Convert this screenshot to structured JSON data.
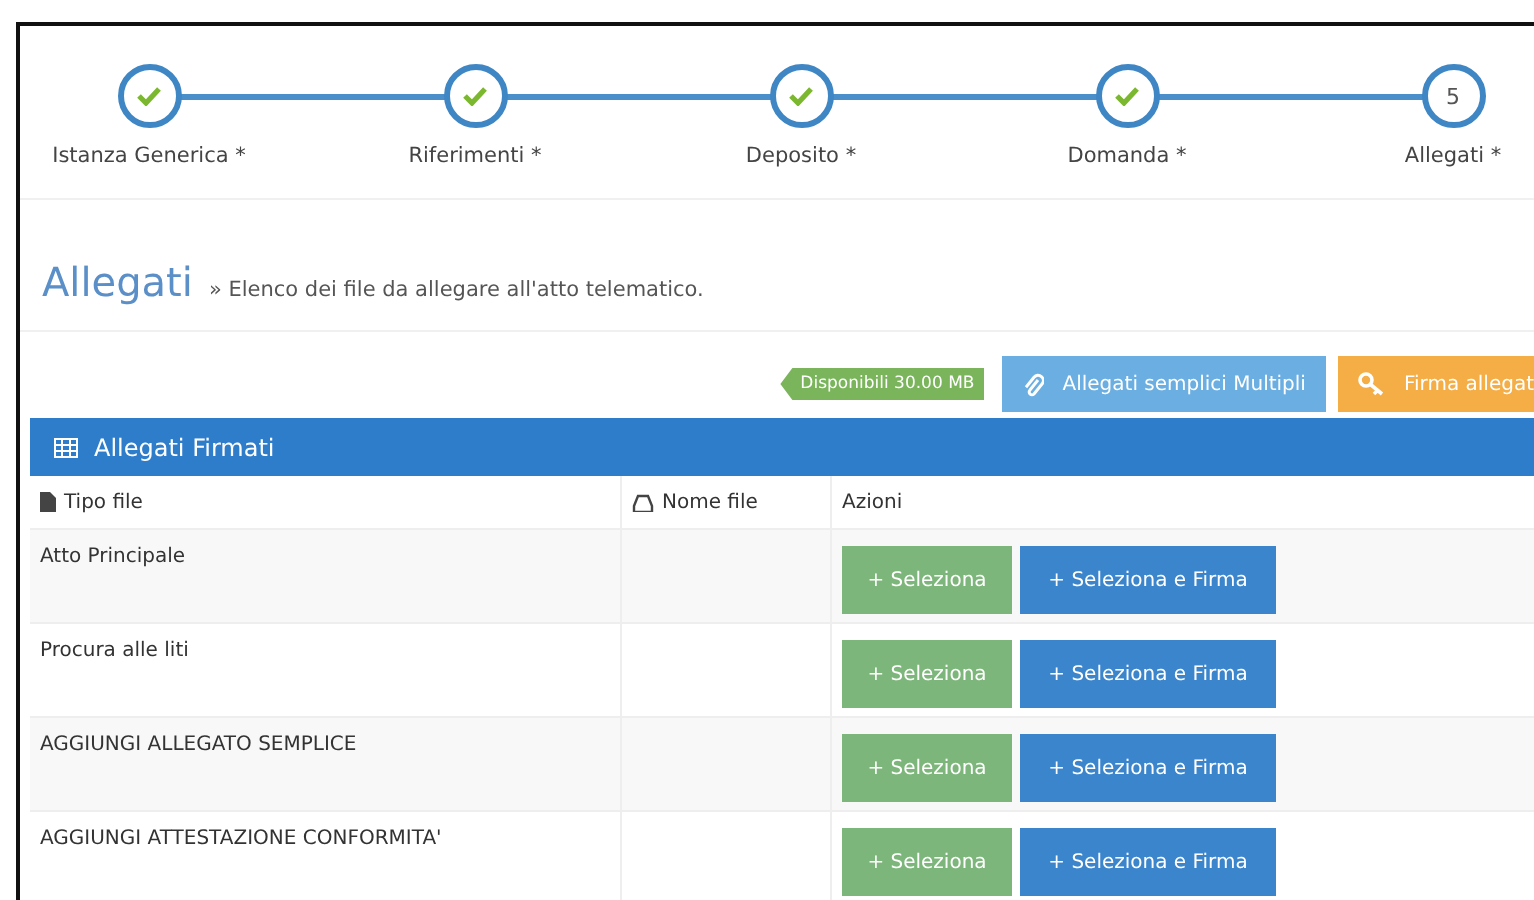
{
  "steps": [
    {
      "label": "Istanza Generica *",
      "done": true
    },
    {
      "label": "Riferimenti *",
      "done": true
    },
    {
      "label": "Deposito *",
      "done": true
    },
    {
      "label": "Domanda *",
      "done": true
    },
    {
      "label": "Allegati *",
      "done": false,
      "number": "5"
    }
  ],
  "heading": {
    "title": "Allegati",
    "subtitle": "» Elenco dei file da allegare all'atto telematico."
  },
  "toolbar": {
    "badge": "Disponibili 30.00 MB",
    "buttons": [
      {
        "kind": "attach",
        "label": "Allegati semplici Multipli"
      },
      {
        "kind": "sign",
        "label": "Firma allegat"
      }
    ]
  },
  "panel": {
    "title": "Allegati Firmati",
    "columns": [
      "Tipo file",
      "Nome file",
      "Azioni"
    ],
    "rows": [
      {
        "type": "Atto Principale",
        "select": "+ Seleziona",
        "sign": "+ Seleziona e Firma"
      },
      {
        "type": "Procura alle liti",
        "select": "+ Seleziona",
        "sign": "+ Seleziona e Firma"
      },
      {
        "type": "AGGIUNGI ALLEGATO SEMPLICE",
        "select": "+ Seleziona",
        "sign": "+ Seleziona e Firma"
      },
      {
        "type": "AGGIUNGI ATTESTAZIONE CONFORMITA'",
        "select": "+ Seleziona",
        "sign": "+ Seleziona e Firma"
      }
    ]
  }
}
